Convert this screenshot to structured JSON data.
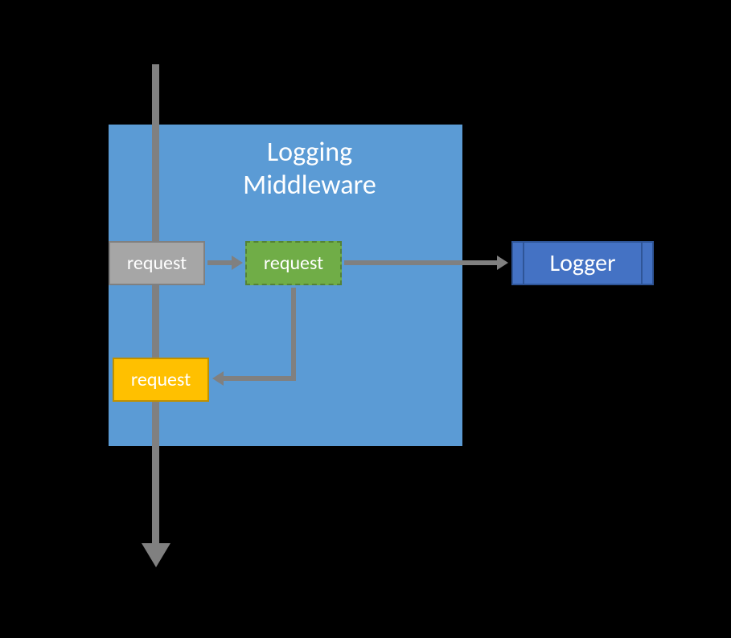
{
  "diagram": {
    "middleware_title_line1": "Logging",
    "middleware_title_line2": "Middleware",
    "request_gray": "request",
    "request_green": "request",
    "request_yellow": "request",
    "logger_label": "Logger"
  },
  "colors": {
    "middleware_bg": "#5B9BD5",
    "arrow": "#808080",
    "gray_box": "#A6A6A6",
    "green_box": "#70AD47",
    "yellow_box": "#FFC000",
    "logger_box": "#4472C4"
  }
}
